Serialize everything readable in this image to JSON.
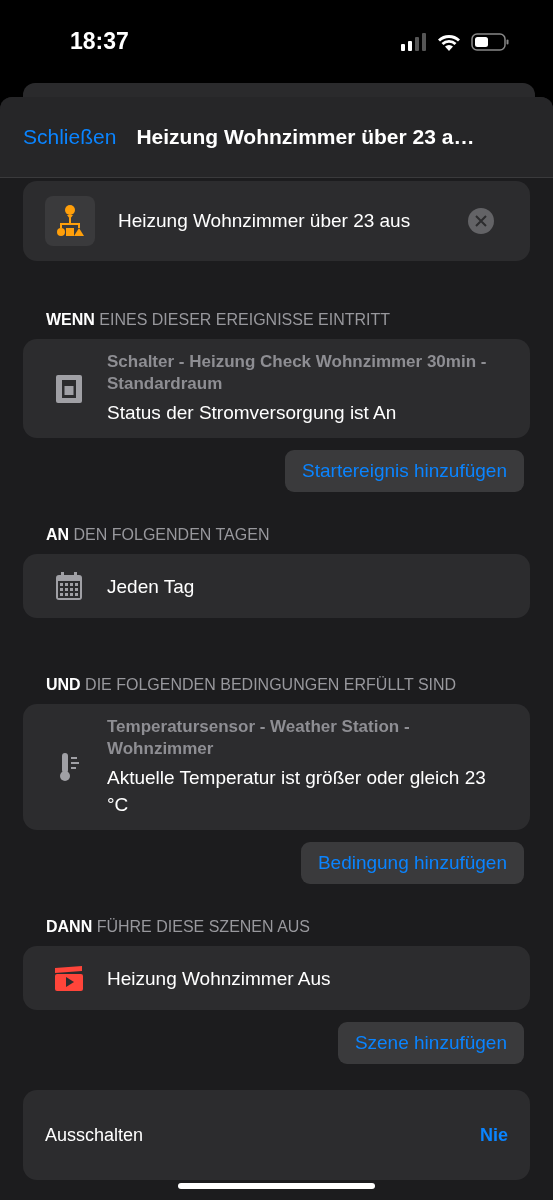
{
  "status_bar": {
    "time": "18:37"
  },
  "header": {
    "close": "Schließen",
    "title": "Heizung Wohnzimmer über 23 a…"
  },
  "automation": {
    "name": "Heizung Wohnzimmer über 23 aus"
  },
  "sections": [
    {
      "heading": "**WENN** EINES DIESER EREIGNISSE EINTRITT",
      "items": [
        {
          "kind": "switch",
          "subtitle": "Schalter - Heizung Check Wohnzimmer 30min - Standardraum",
          "text": "Status der Stromversorgung ist An"
        }
      ],
      "add_button": "Startereignis hinzufügen"
    },
    {
      "heading": "**AN** DEN FOLGENDEN TAGEN",
      "items": [
        {
          "kind": "calendar",
          "text": "Jeden Tag"
        }
      ]
    },
    {
      "heading": "**UND** DIE FOLGENDEN BEDINGUNGEN ERFÜLLT SIND",
      "items": [
        {
          "kind": "thermometer",
          "subtitle": "Temperatursensor - Weather Station - Wohnzimmer",
          "text": "Aktuelle Temperatur ist größer oder gleich 23 °C"
        }
      ],
      "add_button": "Bedingung hinzufügen"
    },
    {
      "heading": "**DANN** FÜHRE DIESE SZENEN AUS",
      "items": [
        {
          "kind": "scene",
          "text": "Heizung Wohnzimmer Aus"
        }
      ],
      "add_button": "Szene hinzufügen"
    }
  ],
  "turn_off": {
    "label": "Ausschalten",
    "value": "Nie"
  }
}
